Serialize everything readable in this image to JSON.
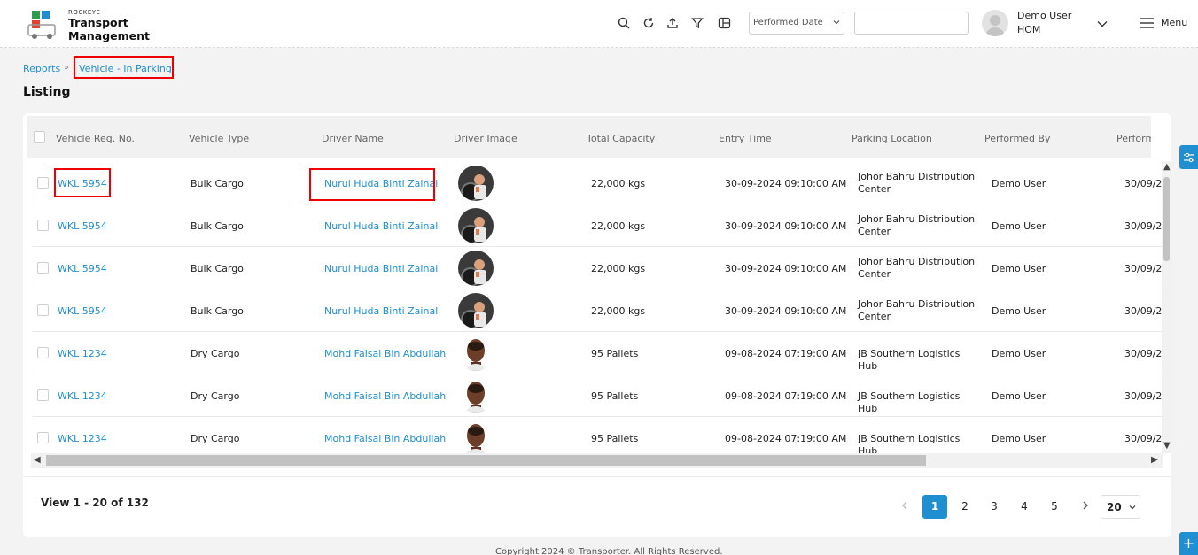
{
  "brand": {
    "small": "ROCKEYE",
    "line1": "Transport",
    "line2": "Management"
  },
  "header": {
    "date_filter": "Performed Date",
    "text_filter": "",
    "user_name": "Demo User",
    "user_org": "HOM",
    "menu_label": "Menu"
  },
  "breadcrumb": {
    "reports": "Reports",
    "sep": "»",
    "current": "Vehicle - In Parking"
  },
  "page": {
    "title": "Listing"
  },
  "columns": [
    "Vehicle Reg. No.",
    "Vehicle Type",
    "Driver Name",
    "Driver Image",
    "Total Capacity",
    "Entry Time",
    "Parking Location",
    "Performed By",
    "Perform"
  ],
  "rows": [
    {
      "reg": "WKL 5954",
      "type": "Bulk Cargo",
      "driver": "Nurul Huda Binti Zainal",
      "img": "driver-a",
      "capacity": "22,000 kgs",
      "entry": "30-09-2024 09:10:00 AM",
      "location": "Johor Bahru Distribution Center",
      "by": "Demo User",
      "performed": "30/09/2"
    },
    {
      "reg": "WKL 5954",
      "type": "Bulk Cargo",
      "driver": "Nurul Huda Binti Zainal",
      "img": "driver-a",
      "capacity": "22,000 kgs",
      "entry": "30-09-2024 09:10:00 AM",
      "location": "Johor Bahru Distribution Center",
      "by": "Demo User",
      "performed": "30/09/2"
    },
    {
      "reg": "WKL 5954",
      "type": "Bulk Cargo",
      "driver": "Nurul Huda Binti Zainal",
      "img": "driver-a",
      "capacity": "22,000 kgs",
      "entry": "30-09-2024 09:10:00 AM",
      "location": "Johor Bahru Distribution Center",
      "by": "Demo User",
      "performed": "30/09/2"
    },
    {
      "reg": "WKL 5954",
      "type": "Bulk Cargo",
      "driver": "Nurul Huda Binti Zainal",
      "img": "driver-a",
      "capacity": "22,000 kgs",
      "entry": "30-09-2024 09:10:00 AM",
      "location": "Johor Bahru Distribution Center",
      "by": "Demo User",
      "performed": "30/09/2"
    },
    {
      "reg": "WKL 1234",
      "type": "Dry Cargo",
      "driver": "Mohd Faisal Bin Abdullah",
      "img": "driver-b",
      "capacity": "95 Pallets",
      "entry": "09-08-2024 07:19:00 AM",
      "location": "JB Southern Logistics Hub",
      "by": "Demo User",
      "performed": "30/09/2"
    },
    {
      "reg": "WKL 1234",
      "type": "Dry Cargo",
      "driver": "Mohd Faisal Bin Abdullah",
      "img": "driver-b",
      "capacity": "95 Pallets",
      "entry": "09-08-2024 07:19:00 AM",
      "location": "JB Southern Logistics Hub",
      "by": "Demo User",
      "performed": "30/09/2"
    },
    {
      "reg": "WKL 1234",
      "type": "Dry Cargo",
      "driver": "Mohd Faisal Bin Abdullah",
      "img": "driver-b",
      "capacity": "95 Pallets",
      "entry": "09-08-2024 07:19:00 AM",
      "location": "JB Southern Logistics Hub",
      "by": "Demo User",
      "performed": "30/09/2"
    }
  ],
  "footer": {
    "view_count": "View 1 - 20 of 132",
    "pages": [
      "1",
      "2",
      "3",
      "4",
      "5"
    ],
    "active_page": "1",
    "page_size": "20"
  },
  "copyright": "Copyright 2024 © Transporter. All Rights Reserved.",
  "colors": {
    "accent": "#1f8fd1",
    "highlight": "#e00000"
  }
}
